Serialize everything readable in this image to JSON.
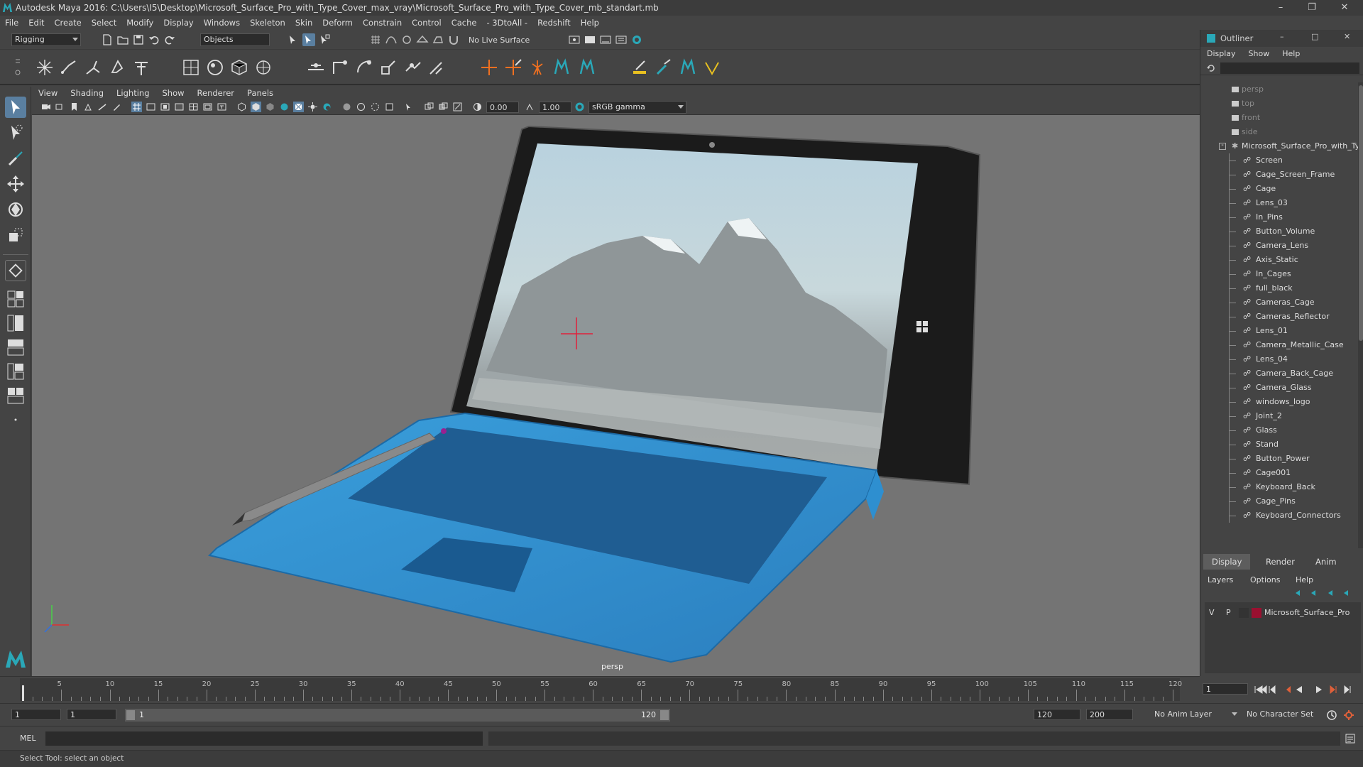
{
  "app": {
    "title": "Autodesk Maya 2016: C:\\Users\\I5\\Desktop\\Microsoft_Surface_Pro_with_Type_Cover_max_vray\\Microsoft_Surface_Pro_with_Type_Cover_mb_standart.mb"
  },
  "menubar": [
    "File",
    "Edit",
    "Create",
    "Select",
    "Modify",
    "Display",
    "Windows",
    "Skeleton",
    "Skin",
    "Deform",
    "Constrain",
    "Control",
    "Cache",
    "- 3DtoAll -",
    "Redshift",
    "Help"
  ],
  "statusline": {
    "mode": "Rigging",
    "selection_mask": "Objects",
    "live_surface": "No Live Surface"
  },
  "viewport": {
    "menu": [
      "View",
      "Shading",
      "Lighting",
      "Show",
      "Renderer",
      "Panels"
    ],
    "exposure": "0.00",
    "gamma": "1.00",
    "color_space": "sRGB gamma",
    "camera_label": "persp"
  },
  "outliner": {
    "title": "Outliner",
    "menu": [
      "Display",
      "Show",
      "Help"
    ],
    "cameras": [
      "persp",
      "top",
      "front",
      "side"
    ],
    "root": "Microsoft_Surface_Pro_with_Type_Cover",
    "children": [
      "Screen",
      "Cage_Screen_Frame",
      "Cage",
      "Lens_03",
      "In_Pins",
      "Button_Volume",
      "Camera_Lens",
      "Axis_Static",
      "In_Cages",
      "full_black",
      "Cameras_Cage",
      "Cameras_Reflector",
      "Lens_01",
      "Camera_Metallic_Case",
      "Lens_04",
      "Camera_Back_Cage",
      "Camera_Glass",
      "windows_logo",
      "Joint_2",
      "Glass",
      "Stand",
      "Button_Power",
      "Cage001",
      "Keyboard_Back",
      "Cage_Pins",
      "Keyboard_Connectors"
    ]
  },
  "layers": {
    "tabs": [
      "Display",
      "Render",
      "Anim"
    ],
    "active_tab": "Display",
    "menu": [
      "Layers",
      "Options",
      "Help"
    ],
    "layer": {
      "v": "V",
      "p": "P",
      "name": "Microsoft_Surface_Pro",
      "color": "#9a1030"
    }
  },
  "timeline": {
    "ticks": [
      5,
      10,
      15,
      20,
      25,
      30,
      35,
      40,
      45,
      50,
      55,
      60,
      65,
      70,
      75,
      80,
      85,
      90,
      95,
      100,
      105,
      110,
      115,
      120
    ],
    "min": 1,
    "max": 120,
    "current_frame": "1"
  },
  "range": {
    "start": "1",
    "playback_start": "1",
    "slider_start": "1",
    "slider_end": "120",
    "playback_end": "120",
    "end": "200",
    "anim_layer": "No Anim Layer",
    "character_set": "No Character Set"
  },
  "cmdline": {
    "label": "MEL"
  },
  "helpline": {
    "text": "Select Tool: select an object"
  },
  "colors": {
    "accent": "#2aa8b8",
    "keyboard": "#2f8fd0",
    "manipulator": "#e0203a"
  }
}
